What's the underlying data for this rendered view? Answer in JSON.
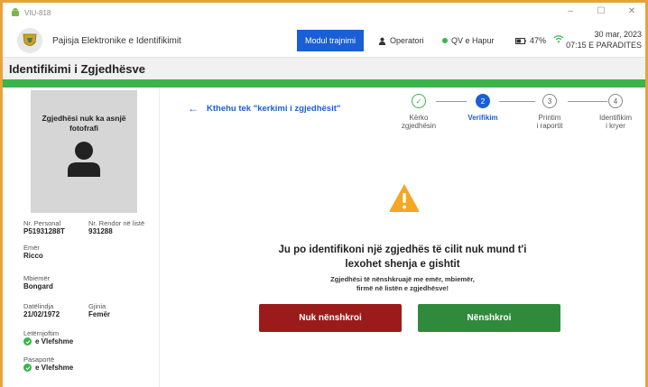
{
  "window": {
    "title": "VIU-818",
    "controls": [
      "–",
      "☐",
      "✕"
    ]
  },
  "appbar": {
    "app_name": "Pajisja Elektronike e Identifikimit",
    "mode_button": "Modul trajnimi",
    "operator": "Operatori",
    "status": "QV e Hapur",
    "battery": "47%",
    "date": "30 mar, 2023",
    "time": "07:15 E PARADITES",
    "colors": {
      "mode_button": "#1a5fd6",
      "status_dot": "#3bb54a"
    }
  },
  "page": {
    "title": "Identifikimi i Zgjedhësve",
    "accent": "#39b54a"
  },
  "sidebar": {
    "photo_text": "Zgjedhësi nuk ka asnjë fotofrafi",
    "personal_no": {
      "label": "Nr. Personal",
      "value": "P51931288T"
    },
    "list_no": {
      "label": "Nr. Rendor në listë",
      "value": "931288"
    },
    "first_name": {
      "label": "Emër",
      "value": "Ricco"
    },
    "last_name": {
      "label": "Mbiemër",
      "value": "Bongard"
    },
    "birth_date": {
      "label": "Datëlindja",
      "value": "21/02/1972"
    },
    "gender": {
      "label": "Gjinia",
      "value": "Femër"
    },
    "id_card": {
      "label": "Letërnjoftim",
      "value": "e Vlefshme"
    },
    "passport": {
      "label": "Pasaportë",
      "value": "e Vlefshme"
    }
  },
  "main": {
    "back_link": "Kthehu tek \"kerkimi i zgjedhësit\"",
    "steps": [
      {
        "number": "✓",
        "label_1": "Kërko",
        "label_2": "zgjedhësin",
        "state": "done"
      },
      {
        "number": "2",
        "label_1": "Verifikim",
        "label_2": "",
        "state": "active"
      },
      {
        "number": "3",
        "label_1": "Printim",
        "label_2": "i raportit",
        "state": "pending"
      },
      {
        "number": "4",
        "label_1": "Identifikim",
        "label_2": "i kryer",
        "state": "pending"
      }
    ],
    "message_title_1": "Ju po identifikoni një zgjedhës të cilit nuk mund t'i",
    "message_title_2": "lexohet shenja e gishtit",
    "message_sub_1": "Zgjedhësi të nënshkruajë me emër, mbiemër,",
    "message_sub_2": "firmë në listën e zgjedhësve!",
    "button_no": "Nuk nënshkroi",
    "button_yes": "Nënshkroi",
    "colors": {
      "link": "#1a5fd6",
      "warning": "#f5a623",
      "button_no": "#9b1b1b",
      "button_yes": "#2f8a3c"
    },
    "icons": [
      "arrow-left-icon",
      "warning-triangle-icon",
      "check-icon"
    ]
  }
}
